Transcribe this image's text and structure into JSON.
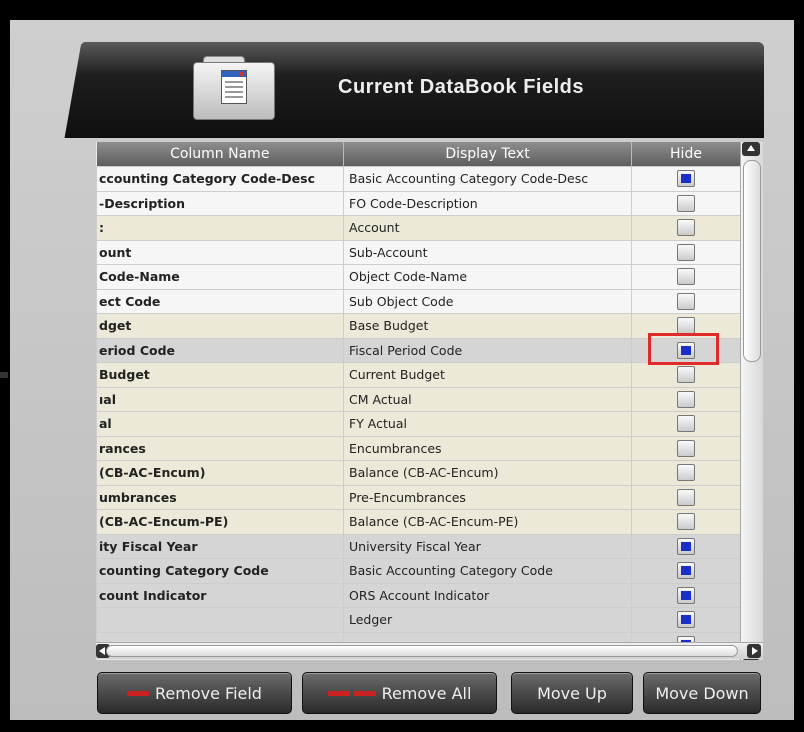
{
  "header": {
    "title": "Current DataBook Fields",
    "icon": "folder-icon"
  },
  "columns": {
    "name": "Column Name",
    "display": "Display Text",
    "hide": "Hide"
  },
  "rows": [
    {
      "name": "ccounting Category Code-Desc",
      "display": "Basic Accounting Category Code-Desc",
      "hidden": true,
      "style": "odd"
    },
    {
      "name": "-Description",
      "display": "FO Code-Description",
      "hidden": false,
      "style": "odd"
    },
    {
      "name": ":",
      "display": "Account",
      "hidden": false,
      "style": "even"
    },
    {
      "name": "ount",
      "display": "Sub-Account",
      "hidden": false,
      "style": "odd"
    },
    {
      "name": "Code-Name",
      "display": "Object Code-Name",
      "hidden": false,
      "style": "odd"
    },
    {
      "name": "ect Code",
      "display": "Sub Object Code",
      "hidden": false,
      "style": "odd"
    },
    {
      "name": "dget",
      "display": "Base Budget",
      "hidden": false,
      "style": "even"
    },
    {
      "name": "eriod Code",
      "display": "Fiscal Period Code",
      "hidden": true,
      "style": "grey"
    },
    {
      "name": " Budget",
      "display": "Current Budget",
      "hidden": false,
      "style": "even"
    },
    {
      "name": "ıal",
      "display": "CM Actual",
      "hidden": false,
      "style": "even"
    },
    {
      "name": "al",
      "display": "FY Actual",
      "hidden": false,
      "style": "even"
    },
    {
      "name": "rances",
      "display": "Encumbrances",
      "hidden": false,
      "style": "even"
    },
    {
      "name": " (CB-AC-Encum)",
      "display": "Balance (CB-AC-Encum)",
      "hidden": false,
      "style": "even"
    },
    {
      "name": "umbrances",
      "display": "Pre-Encumbrances",
      "hidden": false,
      "style": "even"
    },
    {
      "name": " (CB-AC-Encum-PE)",
      "display": "Balance (CB-AC-Encum-PE)",
      "hidden": false,
      "style": "even"
    },
    {
      "name": "ity Fiscal Year",
      "display": "University Fiscal Year",
      "hidden": true,
      "style": "grey"
    },
    {
      "name": "counting Category Code",
      "display": "Basic Accounting Category Code",
      "hidden": true,
      "style": "grey"
    },
    {
      "name": "count Indicator",
      "display": "ORS Account Indicator",
      "hidden": true,
      "style": "grey"
    },
    {
      "name": "",
      "display": "Ledger",
      "hidden": true,
      "style": "grey"
    },
    {
      "name": "",
      "display": "",
      "hidden": true,
      "style": "grey"
    }
  ],
  "buttons": {
    "remove_field": "Remove Field",
    "remove_all": "Remove All",
    "move_up": "Move Up",
    "move_down": "Move Down"
  },
  "colors": {
    "accent_red": "#cc2222",
    "checkbox_blue": "#1a2ec8",
    "highlight": "#e12b2b"
  }
}
